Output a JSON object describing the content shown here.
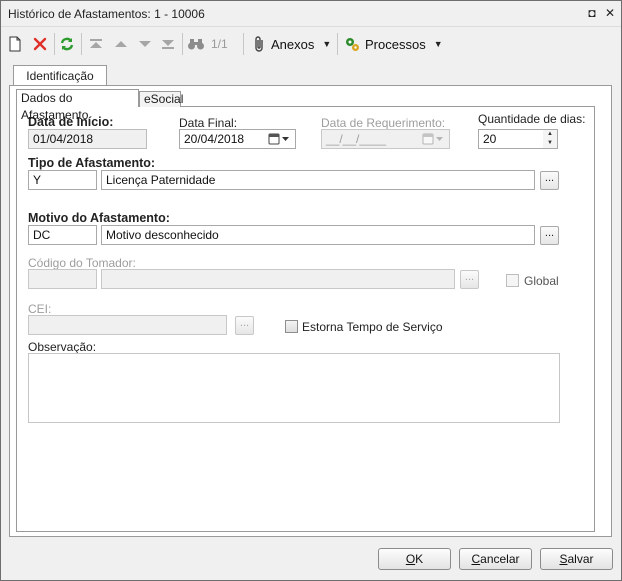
{
  "window": {
    "title": "Histórico de Afastamentos: 1 - 10006",
    "restore_glyph": "◘",
    "close_glyph": "✕"
  },
  "toolbar": {
    "pager": "1/1",
    "attachments_label": "Anexos",
    "processes_label": "Processos",
    "caret": "▼"
  },
  "tabs": {
    "outer": "Identificação",
    "inner": [
      "Dados do Afastamento",
      "eSocial"
    ]
  },
  "form": {
    "start_date": {
      "label": "Data de Início:",
      "value": "01/04/2018"
    },
    "end_date": {
      "label": "Data Final:",
      "value": "20/04/2018"
    },
    "request_date": {
      "label": "Data de Requerimento:",
      "value": "__/__/____"
    },
    "days": {
      "label": "Quantidade de dias:",
      "value": "20"
    },
    "leave_type": {
      "label": "Tipo de Afastamento:",
      "code": "Y",
      "description": "Licença Paternidade"
    },
    "reason": {
      "label": "Motivo do Afastamento:",
      "code": "DC",
      "description": "Motivo desconhecido"
    },
    "taker_code": {
      "label": "Código do Tomador:",
      "code": "",
      "description": ""
    },
    "global": {
      "label": "Global",
      "checked": false
    },
    "cei": {
      "label": "CEI:",
      "value": ""
    },
    "reverse_service_time": {
      "label": "Estorna Tempo de Serviço",
      "checked": false
    },
    "notes": {
      "label": "Observação:",
      "value": ""
    },
    "lookup_glyph": "..."
  },
  "footer": {
    "ok_mnemonic": "O",
    "ok_rest": "K",
    "cancel_mnemonic": "C",
    "cancel_rest": "ancelar",
    "save_mnemonic": "S",
    "save_rest": "alvar"
  },
  "colors": {
    "delete_red": "#e0302a",
    "refresh_green": "#2e9b2e",
    "disabled_text": "#9d9d9d"
  }
}
